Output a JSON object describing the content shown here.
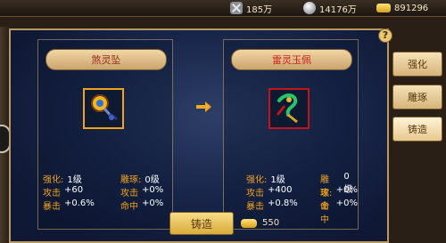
{
  "topbar": {
    "resources": [
      {
        "icon": "swords-icon",
        "value": "185万"
      },
      {
        "icon": "silver-coin-icon",
        "value": "14176万"
      },
      {
        "icon": "gold-ingot-icon",
        "value": "891296"
      }
    ]
  },
  "panel": {
    "help_label": "?",
    "left_item": {
      "name": "煞灵坠",
      "stats": {
        "left": [
          {
            "label": "强化:",
            "value": "1级"
          },
          {
            "label": "攻击",
            "value": "+60"
          },
          {
            "label": "暴击",
            "value": "+0.6%"
          }
        ],
        "right": [
          {
            "label": "雕琢:",
            "value": "0级"
          },
          {
            "label": "攻击",
            "value": "+0%"
          },
          {
            "label": "命中",
            "value": "+0%"
          }
        ]
      }
    },
    "right_item": {
      "name": "雷灵玉佩",
      "stats": {
        "left": [
          {
            "label": "强化:",
            "value": "1级"
          },
          {
            "label": "攻击",
            "value": "+400"
          },
          {
            "label": "暴击",
            "value": "+0.8%"
          }
        ],
        "right": [
          {
            "label": "雕琢:",
            "value": "0级"
          },
          {
            "label": "攻击",
            "value": "+0%"
          },
          {
            "label": "命中",
            "value": "+0%"
          }
        ]
      }
    },
    "forge_button": "铸造",
    "cost_value": "550"
  },
  "side_tabs": [
    {
      "label": "强化"
    },
    {
      "label": "雕琢"
    },
    {
      "label": "铸造"
    }
  ],
  "colors": {
    "accent": "#f0a21a",
    "rare_red": "#d21e1e",
    "panel_bg": "#19264a",
    "button_gold": "#d9aa3b"
  }
}
